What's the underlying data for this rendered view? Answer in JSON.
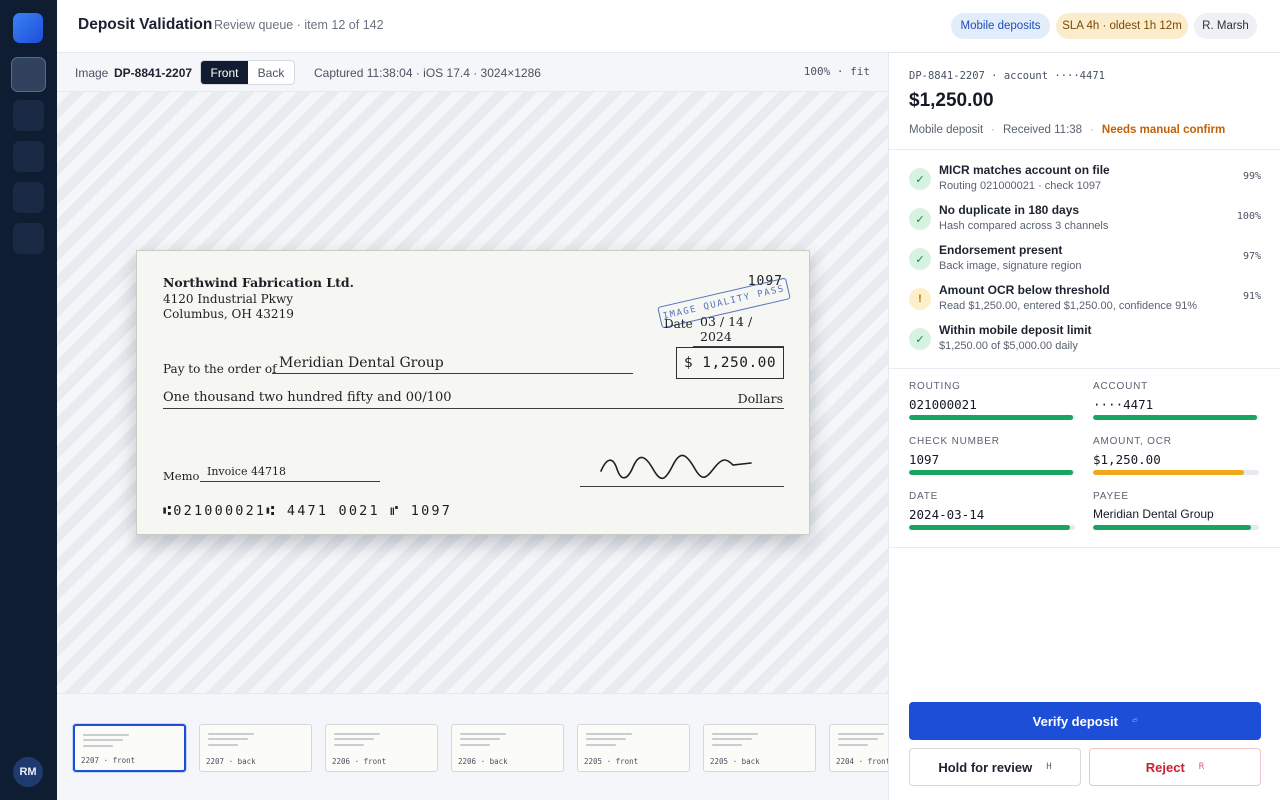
{
  "app": {
    "title": "Deposit Validation",
    "subtitle": "Review queue · item 12 of 142",
    "user_initials": "RM"
  },
  "header_pills": {
    "mobile": "Mobile deposits",
    "sla": "SLA 4h · oldest 1h 12m",
    "user": "R. Marsh"
  },
  "image_toolbar": {
    "label": "Image",
    "image_id": "DP-8841-2207",
    "front_label": "Front",
    "back_label": "Back",
    "active_side": "Front",
    "captured": "Captured 11:38:04 · iOS 17.4 · 3024×1286",
    "zoom": "100% · fit"
  },
  "check": {
    "company": "Northwind Fabrication Ltd.",
    "address1": "4120 Industrial Pkwy",
    "address2": "Columbus, OH 43219",
    "number": "1097",
    "stamp": "IMAGE QUALITY PASS",
    "date_label": "Date",
    "date": "03 / 14 / 2024",
    "pay_label": "Pay to the order of",
    "payee": "Meridian Dental Group",
    "amount": "$ 1,250.00",
    "amount_words": "One thousand two hundred fifty and 00/100",
    "dollars_label": "Dollars",
    "memo_label": "Memo",
    "memo": "Invoice 44718",
    "micr": "⑆021000021⑆ 4471 0021 ⑈ 1097"
  },
  "thumbnails": [
    {
      "label": "2207 · front",
      "active": true
    },
    {
      "label": "2207 · back",
      "active": false
    },
    {
      "label": "2206 · front",
      "active": false
    },
    {
      "label": "2206 · back",
      "active": false
    },
    {
      "label": "2205 · front",
      "active": false
    },
    {
      "label": "2205 · back",
      "active": false
    },
    {
      "label": "2204 · front",
      "active": false
    }
  ],
  "summary": {
    "id_line": "DP-8841-2207 · account ····4471",
    "amount": "$1,250.00",
    "channel": "Mobile deposit",
    "received": "Received 11:38",
    "status": "Needs manual confirm"
  },
  "checks": [
    {
      "title": "MICR matches account on file",
      "detail": "Routing 021000021 · check 1097",
      "score": "99%",
      "status": "ok",
      "icon": "✓"
    },
    {
      "title": "No duplicate in 180 days",
      "detail": "Hash compared across 3 channels",
      "score": "100%",
      "status": "ok",
      "icon": "✓"
    },
    {
      "title": "Endorsement present",
      "detail": "Back image, signature region",
      "score": "97%",
      "status": "ok",
      "icon": "✓"
    },
    {
      "title": "Amount OCR below threshold",
      "detail": "Read $1,250.00, entered $1,250.00, confidence 91%",
      "score": "91%",
      "status": "warn",
      "icon": "!"
    },
    {
      "title": "Within mobile deposit limit",
      "detail": "$1,250.00 of $5,000.00 daily",
      "score": "",
      "status": "ok",
      "icon": "✓"
    }
  ],
  "fields": [
    {
      "label": "ROUTING",
      "value": "021000021",
      "confidence": 0.99,
      "color": "#17a561",
      "mono": true
    },
    {
      "label": "ACCOUNT",
      "value": "····4471",
      "confidence": 0.99,
      "color": "#17a561",
      "mono": true
    },
    {
      "label": "CHECK NUMBER",
      "value": "1097",
      "confidence": 0.99,
      "color": "#17a561",
      "mono": true
    },
    {
      "label": "AMOUNT, OCR",
      "value": "$1,250.00",
      "confidence": 0.91,
      "color": "#f0a91b",
      "mono": true
    },
    {
      "label": "DATE",
      "value": "2024-03-14",
      "confidence": 0.97,
      "color": "#17a561",
      "mono": true
    },
    {
      "label": "PAYEE",
      "value": "Meridian Dental Group",
      "confidence": 0.95,
      "color": "#17a561",
      "mono": false
    }
  ],
  "actions": {
    "verify": "Verify deposit",
    "verify_key": "⏎",
    "hold": "Hold for review",
    "hold_key": "H",
    "reject": "Reject",
    "reject_key": "R"
  },
  "colors": {
    "accent": "#1d4ed8",
    "rail": "#0f1d33",
    "ok": "#17a561",
    "warn": "#f0a91b",
    "danger": "#c9202f"
  }
}
